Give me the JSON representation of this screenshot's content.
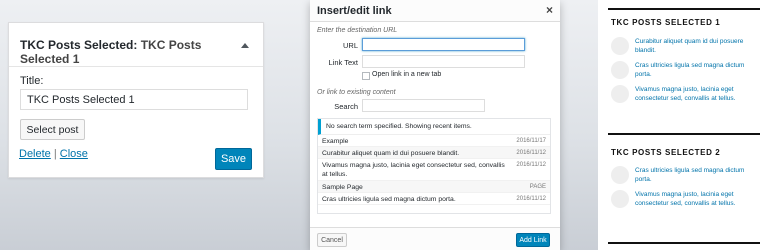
{
  "widget": {
    "header_prefix": "TKC Posts Selected:",
    "header_title": "TKC Posts Selected 1",
    "title_label": "Title:",
    "title_value": "TKC Posts Selected 1",
    "select_post_label": "Select post",
    "delete_label": "Delete",
    "separator": "|",
    "close_label": "Close",
    "save_label": "Save"
  },
  "modal": {
    "title": "Insert/edit link",
    "close_glyph": "×",
    "destination_instruction": "Enter the destination URL",
    "url_label": "URL",
    "url_value": "",
    "link_text_label": "Link Text",
    "link_text_value": "",
    "new_tab_label": "Open link in a new tab",
    "existing_instruction": "Or link to existing content",
    "search_label": "Search",
    "search_value": "",
    "notice": "No search term specified. Showing recent items.",
    "results": [
      {
        "title": "Example",
        "meta": "2016/11/17"
      },
      {
        "title": "Curabitur aliquet quam id dui posuere blandit.",
        "meta": "2016/11/12"
      },
      {
        "title": "Vivamus magna justo, lacinia eget consectetur sed, convallis at tellus.",
        "meta": "2016/11/12"
      },
      {
        "title": "Sample Page",
        "meta": "PAGE"
      },
      {
        "title": "Cras ultricies ligula sed magna dictum porta.",
        "meta": "2016/11/12"
      }
    ],
    "cancel_label": "Cancel",
    "add_link_label": "Add Link"
  },
  "sidebar": {
    "widgets": [
      {
        "title": "TKC POSTS SELECTED 1",
        "items": [
          "Curabitur aliquet quam id dui posuere blandit.",
          "Cras ultricies ligula sed magna dictum porta.",
          "Vivamus magna justo, lacinia eget consectetur sed, convallis at tellus."
        ]
      },
      {
        "title": "TKC POSTS SELECTED 2",
        "items": [
          "Cras ultricies ligula sed magna dictum porta.",
          "Vivamus magna justo, lacinia eget consectetur sed, convallis at tellus."
        ]
      }
    ]
  },
  "colors": {
    "primary_button": "#0085ba",
    "link": "#0073aa",
    "notice_accent": "#00a0d2"
  }
}
